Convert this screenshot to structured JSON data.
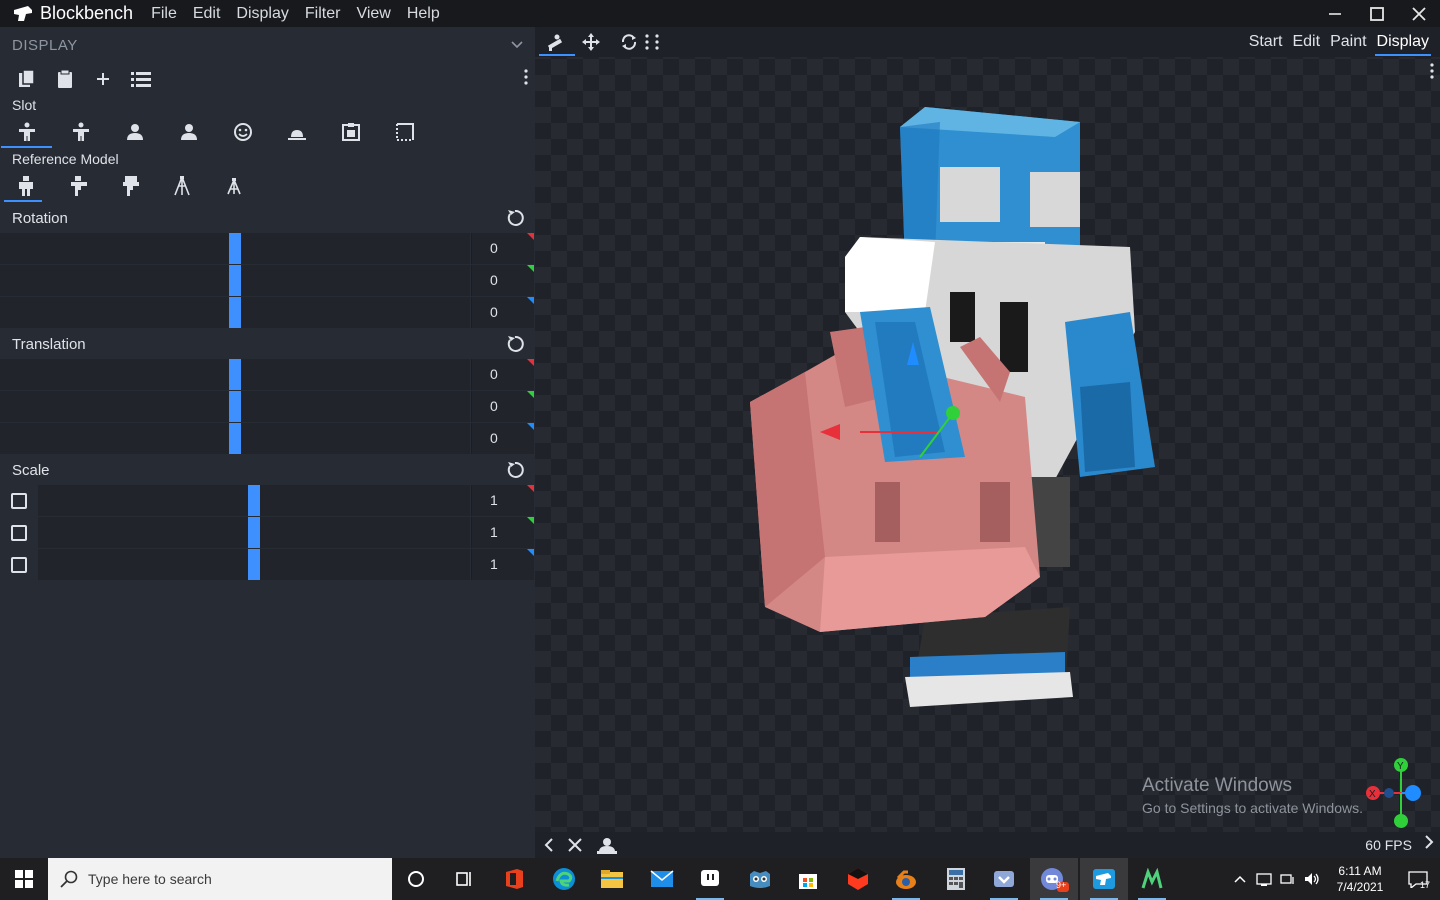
{
  "app": {
    "name": "Blockbench",
    "menu": [
      "File",
      "Edit",
      "Display",
      "Filter",
      "View",
      "Help"
    ]
  },
  "sidebar": {
    "panel_title": "DISPLAY",
    "slot_label": "Slot",
    "reference_label": "Reference Model",
    "sections": {
      "rotation": {
        "title": "Rotation",
        "values": [
          "0",
          "0",
          "0"
        ]
      },
      "translation": {
        "title": "Translation",
        "values": [
          "0",
          "0",
          "0"
        ]
      },
      "scale": {
        "title": "Scale",
        "values": [
          "1",
          "1",
          "1"
        ]
      }
    }
  },
  "viewport": {
    "modes": [
      "Start",
      "Edit",
      "Paint",
      "Display"
    ],
    "active_mode": "Display",
    "fps": "60 FPS",
    "watermark_title": "Activate Windows",
    "watermark_sub": "Go to Settings to activate Windows.",
    "gizmo": {
      "y": "Y",
      "x": "X"
    }
  },
  "taskbar": {
    "search_placeholder": "Type here to search",
    "time": "6:11 AM",
    "date": "7/4/2021",
    "notification_count": "17",
    "chat_badge": "9+"
  },
  "colors": {
    "accent": "#3e90ff",
    "axis_x": "#e8303a",
    "axis_y": "#2fd03a",
    "axis_z": "#1f8cff"
  }
}
